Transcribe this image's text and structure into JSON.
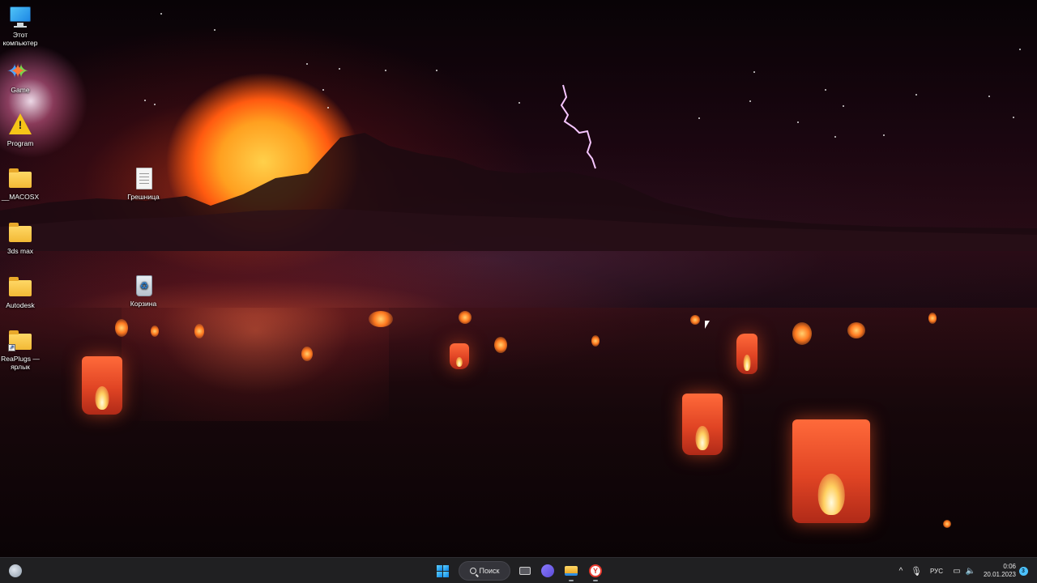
{
  "desktop_icons": [
    {
      "label": "Этот компьютер",
      "icon": "computer-icon"
    },
    {
      "label": "Game",
      "icon": "game-icon"
    },
    {
      "label": "Program",
      "icon": "warning-icon"
    },
    {
      "label": "__MACOSX",
      "icon": "folder-icon"
    },
    {
      "label": "3ds max",
      "icon": "folder-icon"
    },
    {
      "label": "Autodesk",
      "icon": "folder-icon"
    },
    {
      "label": "ReaPlugs — ярлык",
      "icon": "folder-shortcut-icon"
    },
    {
      "label": "Грешница",
      "icon": "document-icon"
    },
    {
      "label": "Корзина",
      "icon": "recycle-bin-icon"
    }
  ],
  "taskbar": {
    "search_label": "Поиск",
    "language": "РУС",
    "time": "0:06",
    "date": "20.01.2023",
    "notification_count": "3",
    "icons": [
      "weather-icon",
      "windows-start-icon",
      "search-icon",
      "task-view-icon",
      "chat-icon",
      "file-explorer-icon",
      "yandex-browser-icon",
      "chevron-up-icon",
      "microphone-icon",
      "network-icon",
      "volume-icon"
    ]
  },
  "colors": {
    "taskbar_bg": "#202022",
    "accent": "#4cc2ff",
    "folder": "#f2b935"
  }
}
